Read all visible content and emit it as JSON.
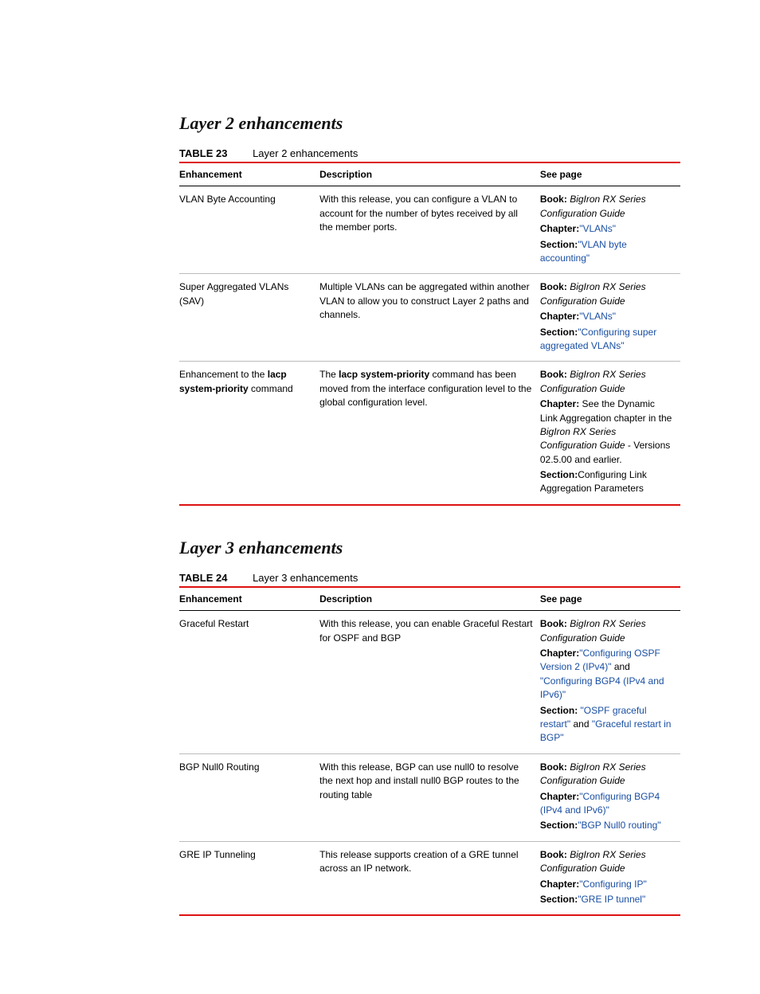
{
  "sections": [
    {
      "heading": "Layer 2 enhancements",
      "table_number": "TABLE 23",
      "table_caption": "Layer 2 enhancements",
      "columns": {
        "c1": "Enhancement",
        "c2": "Description",
        "c3": "See page"
      },
      "rows": [
        {
          "enh": "VLAN Byte Accounting",
          "desc": "With this release, you can configure a VLAN to account for the number of bytes received by all the member ports.",
          "ref": {
            "book_lbl": "Book:",
            "book_val": "BigIron RX Series Configuration Guide",
            "chap_lbl": "Chapter:",
            "chap_links": [
              "\"VLANs\""
            ],
            "chap_plain": "",
            "sect_lbl": "Section:",
            "sect_links": [
              "\"VLAN byte accounting\""
            ],
            "sect_plain": ""
          }
        },
        {
          "enh": "Super Aggregated VLANs (SAV)",
          "desc": "Multiple VLANs can be aggregated within another VLAN to allow you to construct Layer 2 paths and channels.",
          "ref": {
            "book_lbl": "Book:",
            "book_val": "BigIron RX Series Configuration Guide",
            "chap_lbl": "Chapter:",
            "chap_links": [
              "\"VLANs\""
            ],
            "chap_plain": "",
            "sect_lbl": "Section:",
            "sect_links": [
              "\"Configuring super aggregated VLANs\""
            ],
            "sect_plain": ""
          }
        },
        {
          "enh_pre": "Enhancement to the ",
          "enh_bold": "lacp system-priority",
          "enh_post": " command",
          "desc_pre": "The ",
          "desc_bold": "lacp system-priority",
          "desc_post": " command has been moved from the interface configuration level to the global configuration level.",
          "ref": {
            "book_lbl": "Book:",
            "book_val": "BigIron RX Series Configuration Guide",
            "chap_lbl": "Chapter:",
            "chap_plain_pre": " See the Dynamic Link Aggregation chapter in the ",
            "chap_plain_italic": "BigIron RX Series Configuration Guide",
            "chap_plain_post": " - Versions 02.5.00 and earlier.",
            "sect_lbl": "Section:",
            "sect_plain": "Configuring Link Aggregation Parameters"
          }
        }
      ]
    },
    {
      "heading": "Layer 3 enhancements",
      "table_number": "TABLE 24",
      "table_caption": "Layer 3 enhancements",
      "columns": {
        "c1": "Enhancement",
        "c2": "Description",
        "c3": "See page"
      },
      "rows": [
        {
          "enh": "Graceful Restart",
          "desc": "With this release, you can enable Graceful Restart for OSPF and BGP",
          "ref": {
            "book_lbl": "Book:",
            "book_val": "BigIron RX Series Configuration Guide",
            "chap_lbl": "Chapter:",
            "chap_links": [
              "\"Configuring OSPF Version 2 (IPv4)\"",
              "\"Configuring BGP4 (IPv4 and IPv6)\""
            ],
            "chap_join": " and ",
            "sect_lbl": "Section:",
            "sect_links": [
              "\"OSPF graceful restart\"",
              "\"Graceful restart in BGP\""
            ],
            "sect_join": " and "
          }
        },
        {
          "enh": "BGP Null0 Routing",
          "desc": "With this release, BGP can use null0 to resolve the next hop and install null0 BGP routes to the routing table",
          "ref": {
            "book_lbl": "Book:",
            "book_val": "BigIron RX Series Configuration Guide",
            "chap_lbl": "Chapter:",
            "chap_links": [
              "\"Configuring BGP4 (IPv4 and IPv6)\""
            ],
            "sect_lbl": "Section:",
            "sect_links": [
              "\"BGP Null0 routing\""
            ]
          }
        },
        {
          "enh": "GRE IP Tunneling",
          "desc": "This release supports creation of a GRE tunnel across an IP network.",
          "ref": {
            "book_lbl": "Book:",
            "book_val": "BigIron RX Series Configuration Guide",
            "chap_lbl": "Chapter:",
            "chap_links": [
              "\"Configuring IP\""
            ],
            "sect_lbl": "Section:",
            "sect_links": [
              "\"GRE IP tunnel\""
            ]
          }
        }
      ]
    }
  ]
}
